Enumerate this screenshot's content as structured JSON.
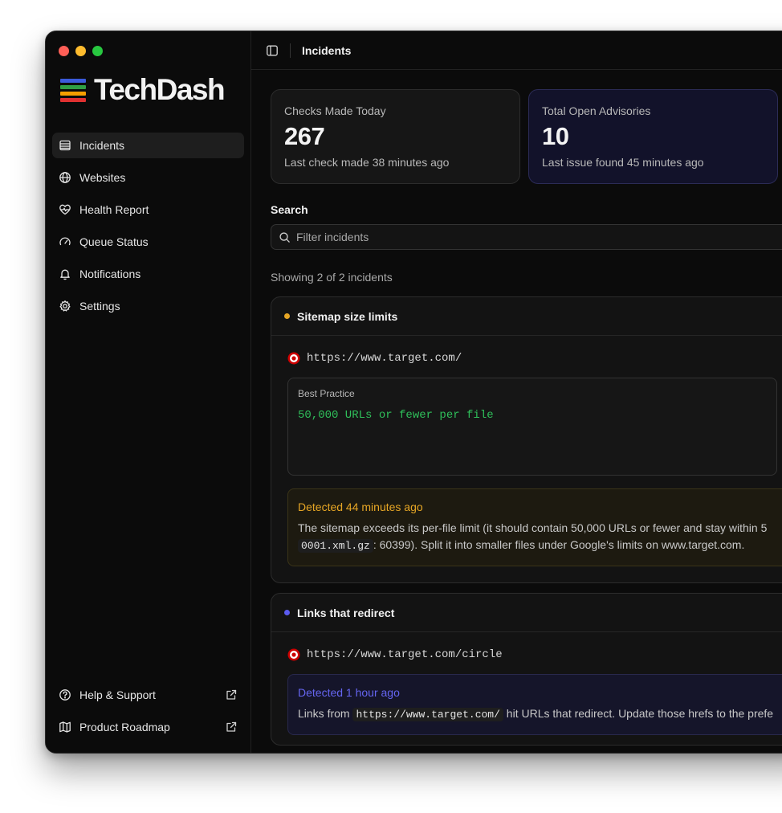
{
  "app": {
    "name": "TechDash"
  },
  "logo": {
    "colors": [
      "#3b5bdb",
      "#2f9e44",
      "#f59f00",
      "#e03131"
    ]
  },
  "sidebar": {
    "items": [
      {
        "label": "Incidents",
        "icon": "list-icon",
        "active": true
      },
      {
        "label": "Websites",
        "icon": "globe-icon"
      },
      {
        "label": "Health Report",
        "icon": "heart-pulse-icon"
      },
      {
        "label": "Queue Status",
        "icon": "gauge-icon"
      },
      {
        "label": "Notifications",
        "icon": "bell-icon"
      },
      {
        "label": "Settings",
        "icon": "gear-icon"
      }
    ],
    "bottom": [
      {
        "label": "Help & Support",
        "icon": "help-circle-icon",
        "external": true
      },
      {
        "label": "Product Roadmap",
        "icon": "map-icon",
        "external": true
      }
    ]
  },
  "header": {
    "title": "Incidents"
  },
  "stats": [
    {
      "label": "Checks Made Today",
      "value": "267",
      "sub": "Last check made 38 minutes ago"
    },
    {
      "label": "Total Open Advisories",
      "value": "10",
      "sub": "Last issue found 45 minutes ago"
    }
  ],
  "search": {
    "label": "Search",
    "placeholder": "Filter incidents"
  },
  "showing": "Showing 2 of 2 incidents",
  "incidents": [
    {
      "title": "Sitemap size limits",
      "dot_color": "#e6a625",
      "url": "https://www.target.com/",
      "best_practice_label": "Best Practice",
      "best_practice_value": "50,000 URLs or fewer per file",
      "detected": "Detected 44 minutes ago",
      "text_line1": "The sitemap exceeds its per-file limit (it should contain 50,000 URLs or fewer and stay within 5",
      "code": "0001.xml.gz",
      "text_line2_rest": ": 60399). Split it into smaller files under Google's limits on www.target.com."
    },
    {
      "title": "Links that redirect",
      "dot_color": "#5b5bf0",
      "url": "https://www.target.com/circle",
      "detected": "Detected 1 hour ago",
      "text_prefix": "Links from",
      "code": "https://www.target.com/",
      "text_suffix": "hit URLs that redirect. Update those hrefs to the prefe"
    }
  ]
}
